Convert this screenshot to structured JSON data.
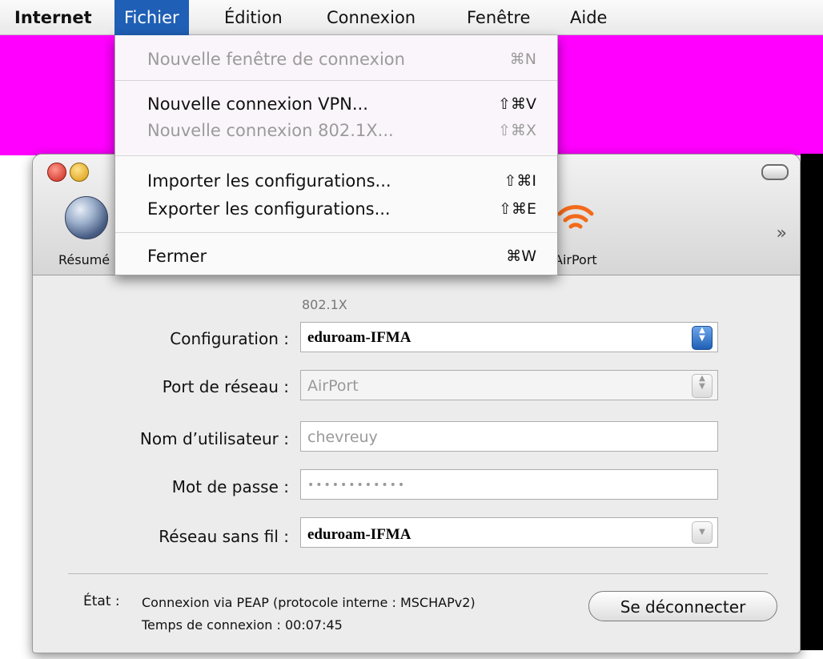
{
  "menubar": {
    "items": [
      {
        "label": "Internet"
      },
      {
        "label": "Fichier"
      },
      {
        "label": "Édition"
      },
      {
        "label": "Connexion"
      },
      {
        "label": "Fenêtre"
      },
      {
        "label": "Aide"
      }
    ]
  },
  "fichier_menu": {
    "items": [
      {
        "label": "Nouvelle fenêtre de connexion",
        "shortcut": "⌘N",
        "enabled": false
      },
      {
        "label": "Nouvelle connexion VPN...",
        "shortcut": "⇧⌘V",
        "enabled": true
      },
      {
        "label": "Nouvelle connexion 802.1X...",
        "shortcut": "⇧⌘X",
        "enabled": false
      },
      {
        "label": "Importer les configurations...",
        "shortcut": "⇧⌘I",
        "enabled": true
      },
      {
        "label": "Exporter les configurations...",
        "shortcut": "⇧⌘E",
        "enabled": true
      },
      {
        "label": "Fermer",
        "shortcut": "⌘W",
        "enabled": true
      }
    ]
  },
  "toolbar": {
    "items": [
      {
        "label": "Résumé",
        "icon": "globe-icon"
      },
      {
        "label": "AirPort",
        "icon": "airport-icon"
      }
    ],
    "overflow_icon": "double-chevron-icon"
  },
  "pane": {
    "section_label": "802.1X",
    "fields": [
      {
        "label": "Configuration :",
        "value": "eduroam-IFMA"
      },
      {
        "label": "Port de réseau :",
        "value": "AirPort"
      },
      {
        "label": "Nom d’utilisateur :",
        "value": "chevreuy"
      },
      {
        "label": "Mot de passe :",
        "value": "••••••••••••"
      },
      {
        "label": "Réseau sans fil :",
        "value": "eduroam-IFMA"
      }
    ]
  },
  "status": {
    "key": "État :",
    "line": "Connexion via PEAP (protocole interne : MSCHAPv2)",
    "time": "Temps de connexion : 00:07:45",
    "button": "Se déconnecter"
  },
  "colors": {
    "desktop": "#ff00ff",
    "menu_highlight": "#1f5fb5"
  }
}
